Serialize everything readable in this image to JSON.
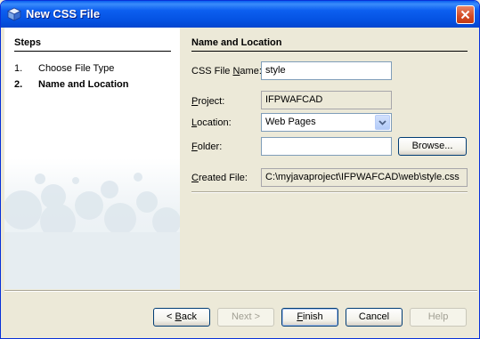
{
  "window": {
    "title": "New CSS File"
  },
  "steps": {
    "heading": "Steps",
    "items": [
      {
        "num": "1.",
        "label": "Choose File Type"
      },
      {
        "num": "2.",
        "label": "Name and Location"
      }
    ]
  },
  "panel": {
    "heading": "Name and Location",
    "css_file_name": {
      "label_u": "N",
      "label_pre": "CSS File ",
      "label_post": "ame:",
      "value": "style"
    },
    "project": {
      "label_u": "P",
      "label_post": "roject:",
      "value": "IFPWAFCAD"
    },
    "location": {
      "label_u": "L",
      "label_post": "ocation:",
      "value": "Web Pages"
    },
    "folder": {
      "label_u": "F",
      "label_post": "older:",
      "value": ""
    },
    "browse_label": "Browse...",
    "created_file": {
      "label_u": "C",
      "label_post": "reated File:",
      "value": "C:\\myjavaproject\\IFPWAFCAD\\web\\style.css"
    }
  },
  "buttons": {
    "back": {
      "pre": "< ",
      "u": "B",
      "post": "ack"
    },
    "next": "Next >",
    "finish": {
      "u": "F",
      "post": "inish"
    },
    "cancel": "Cancel",
    "help": "Help"
  },
  "colors": {
    "titlebar": "#0553e3",
    "dialog_bg": "#ece9d8",
    "field_border": "#7f9db9"
  }
}
